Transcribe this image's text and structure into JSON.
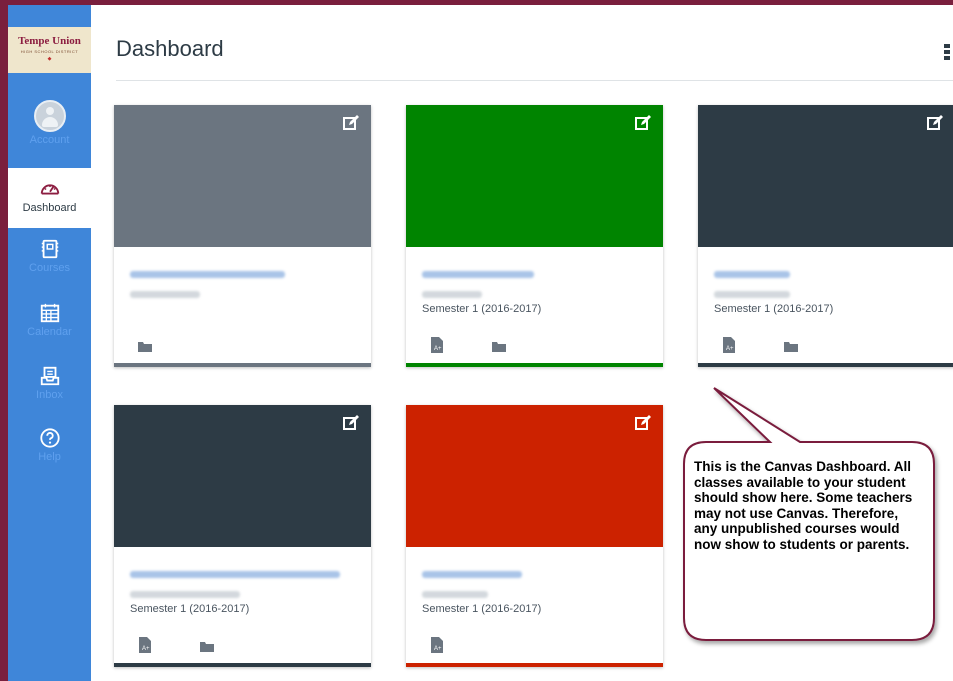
{
  "app": {
    "logo_text": "Tempe Union",
    "logo_subtext": "HIGH SCHOOL DISTRICT"
  },
  "nav": {
    "items": [
      {
        "key": "account",
        "label": "Account",
        "icon": "account-avatar-icon"
      },
      {
        "key": "dashboard",
        "label": "Dashboard",
        "icon": "speedometer-icon"
      },
      {
        "key": "courses",
        "label": "Courses",
        "icon": "courses-book-icon"
      },
      {
        "key": "calendar",
        "label": "Calendar",
        "icon": "calendar-icon"
      },
      {
        "key": "inbox",
        "label": "Inbox",
        "icon": "inbox-icon"
      },
      {
        "key": "help",
        "label": "Help",
        "icon": "help-question-icon"
      }
    ],
    "active": "dashboard"
  },
  "header": {
    "title": "Dashboard",
    "menu_icon": "vertical-dots-icon"
  },
  "cards": [
    {
      "color": "#6b7580",
      "term": "",
      "assignments_icon": false,
      "folder_icon": true,
      "edit_icon": "edit-pencil-icon"
    },
    {
      "color": "#008400",
      "term": "Semester 1 (2016-2017)",
      "assignments_icon": true,
      "folder_icon": true,
      "edit_icon": "edit-pencil-icon"
    },
    {
      "color": "#2d3b45",
      "term": "Semester 1 (2016-2017)",
      "assignments_icon": true,
      "folder_icon": true,
      "edit_icon": "edit-pencil-icon"
    },
    {
      "color": "#2d3b45",
      "term": "Semester 1 (2016-2017)",
      "assignments_icon": true,
      "folder_icon": true,
      "edit_icon": "edit-pencil-icon"
    },
    {
      "color": "#cc2200",
      "term": "Semester 1 (2016-2017)",
      "assignments_icon": true,
      "folder_icon": false,
      "edit_icon": "edit-pencil-icon"
    }
  ],
  "callout": {
    "text": "This is the Canvas Dashboard. All classes available to your student should show here. Some teachers may not use Canvas. Therefore, any unpublished courses would now show to students or parents."
  },
  "colors": {
    "sidebar": "#3f86d9",
    "frame": "#7a1f3d",
    "callout_border": "#7a1f3d"
  }
}
